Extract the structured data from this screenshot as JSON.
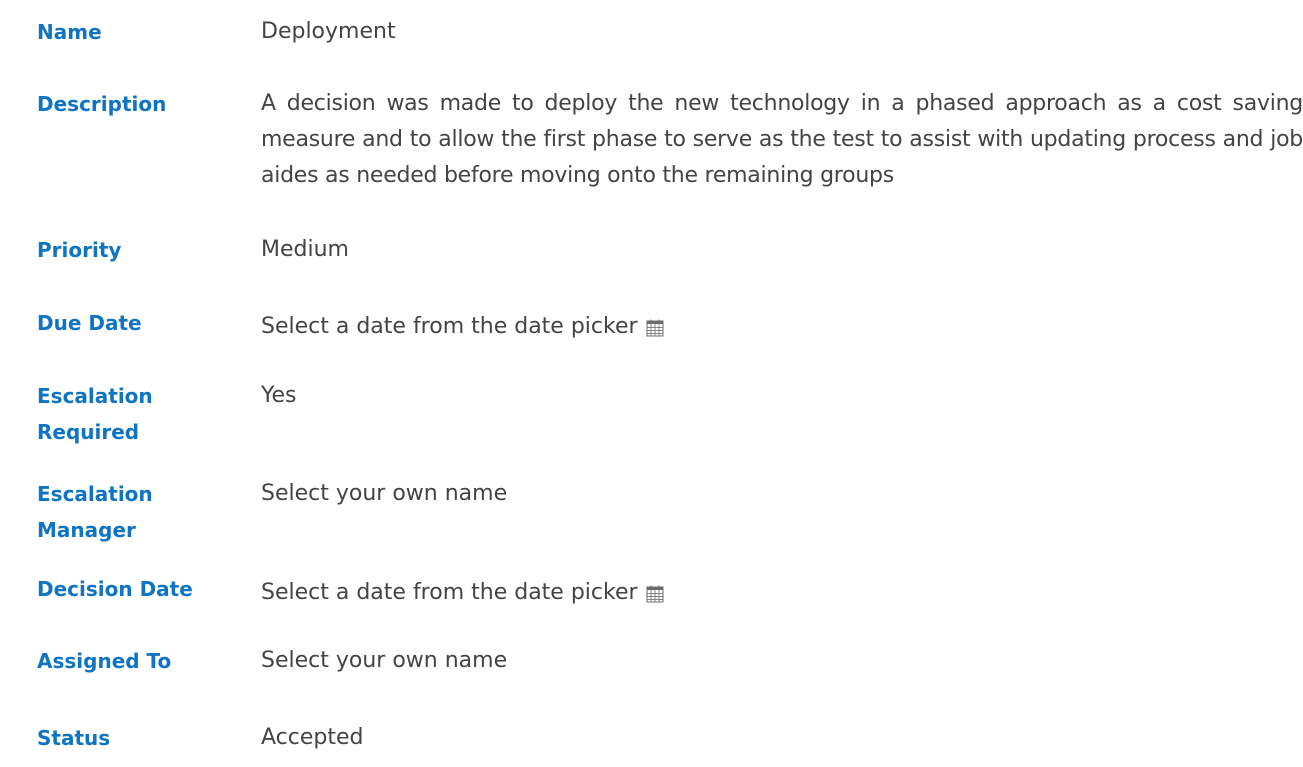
{
  "form": {
    "fields": [
      {
        "label": "Name",
        "value": "Deployment"
      },
      {
        "label": "Description",
        "value": "A decision was made to deploy the new technology in a phased approach as a cost saving measure and to allow the first phase to serve as the test to assist with updating process and job aides as needed before moving onto the remaining groups"
      },
      {
        "label": "Priority",
        "value": "Medium"
      },
      {
        "label": "Due Date",
        "value": "Select a date from the date picker",
        "icon": "calendar-icon"
      },
      {
        "label": "Escalation Required",
        "value": "Yes"
      },
      {
        "label": "Escalation Manager",
        "value": "Select your own name"
      },
      {
        "label": "Decision Date",
        "value": "Select a date from the date picker",
        "icon": "calendar-icon"
      },
      {
        "label": "Assigned To",
        "value": "Select your own name"
      },
      {
        "label": "Status",
        "value": "Accepted"
      }
    ]
  },
  "colors": {
    "label": "#0f74c4",
    "value": "#444444"
  }
}
